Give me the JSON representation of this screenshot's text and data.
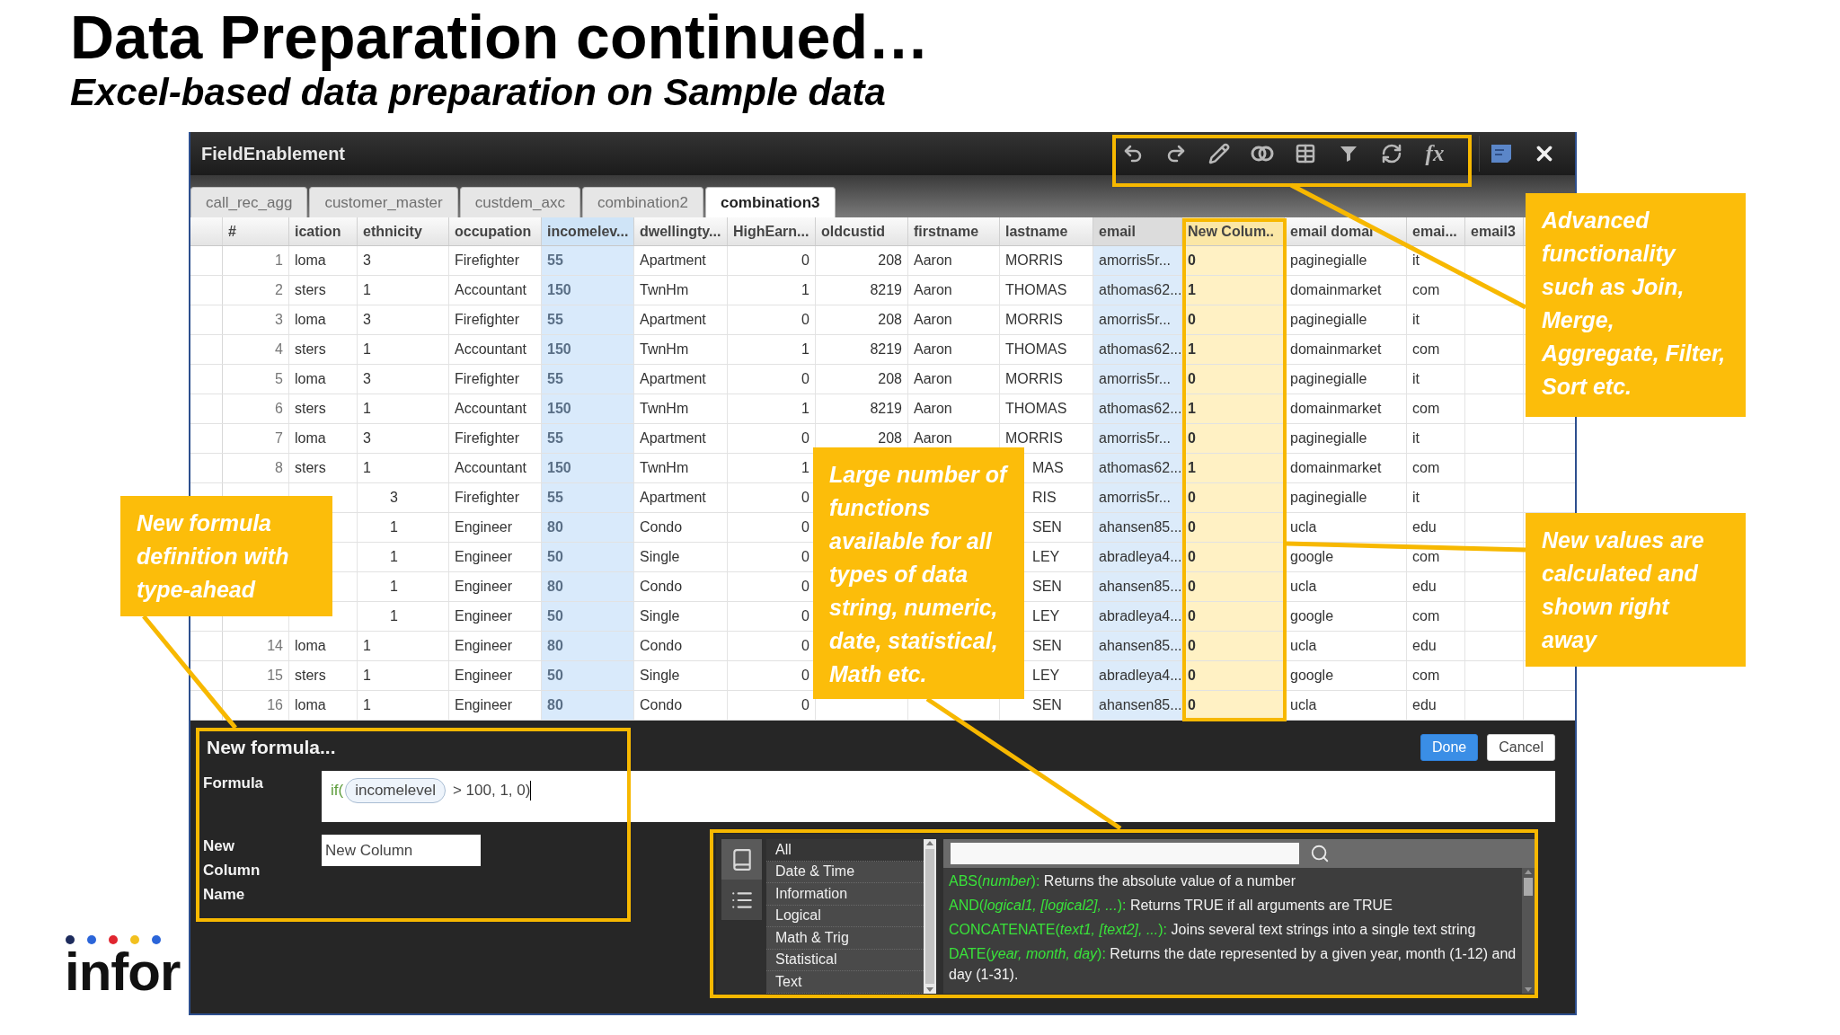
{
  "slide": {
    "title": "Data Preparation continued…",
    "subtitle": "Excel-based data preparation on Sample data",
    "logo": "infor"
  },
  "window": {
    "title": "FieldEnablement",
    "toolbar": [
      {
        "kind": "undo"
      },
      {
        "kind": "redo"
      },
      {
        "kind": "edit"
      },
      {
        "kind": "join"
      },
      {
        "kind": "table"
      },
      {
        "kind": "filter"
      },
      {
        "kind": "refresh"
      },
      {
        "kind": "formula",
        "label": "fx"
      }
    ],
    "actions": [
      {
        "kind": "note"
      },
      {
        "kind": "close"
      }
    ]
  },
  "tabs": [
    {
      "label": "call_rec_agg",
      "selected": false
    },
    {
      "label": "customer_master",
      "selected": false
    },
    {
      "label": "custdem_axc",
      "selected": false
    },
    {
      "label": "combination2",
      "selected": false
    },
    {
      "label": "combination3",
      "selected": true
    }
  ],
  "table": {
    "columns": [
      {
        "label": "#",
        "kind": "index"
      },
      {
        "label": "ication",
        "kind": "text"
      },
      {
        "label": "ethnicity",
        "kind": "text"
      },
      {
        "label": "occupation",
        "kind": "text"
      },
      {
        "label": "incomelev...",
        "kind": "source"
      },
      {
        "label": "dwellingty...",
        "kind": "text"
      },
      {
        "label": "HighEarn...",
        "kind": "number"
      },
      {
        "label": "oldcustid",
        "kind": "number"
      },
      {
        "label": "firstname",
        "kind": "text"
      },
      {
        "label": "lastname",
        "kind": "text"
      },
      {
        "label": "email",
        "kind": "tinted"
      },
      {
        "label": "New Colum..",
        "kind": "computed"
      },
      {
        "label": "email domai",
        "kind": "text"
      },
      {
        "label": "emai...",
        "kind": "text"
      },
      {
        "label": "email3",
        "kind": "text"
      }
    ],
    "rows": [
      {
        "cells": [
          "1",
          "loma",
          "3",
          "Firefighter",
          "55",
          "Apartment",
          "0",
          "208",
          "Aaron",
          "MORRIS",
          "amorris5r...",
          "0",
          "paginegialle",
          "it",
          null
        ]
      },
      {
        "cells": [
          "2",
          "sters",
          "1",
          "Accountant",
          "150",
          "TwnHm",
          "1",
          "8219",
          "Aaron",
          "THOMAS",
          "athomas62...",
          "1",
          "domainmarket",
          "com",
          null
        ]
      },
      {
        "cells": [
          "3",
          "loma",
          "3",
          "Firefighter",
          "55",
          "Apartment",
          "0",
          "208",
          "Aaron",
          "MORRIS",
          "amorris5r...",
          "0",
          "paginegialle",
          "it",
          null
        ]
      },
      {
        "cells": [
          "4",
          "sters",
          "1",
          "Accountant",
          "150",
          "TwnHm",
          "1",
          "8219",
          "Aaron",
          "THOMAS",
          "athomas62...",
          "1",
          "domainmarket",
          "com",
          null
        ]
      },
      {
        "cells": [
          "5",
          "loma",
          "3",
          "Firefighter",
          "55",
          "Apartment",
          "0",
          "208",
          "Aaron",
          "MORRIS",
          "amorris5r...",
          "0",
          "paginegialle",
          "it",
          null
        ]
      },
      {
        "cells": [
          "6",
          "sters",
          "1",
          "Accountant",
          "150",
          "TwnHm",
          "1",
          "8219",
          "Aaron",
          "THOMAS",
          "athomas62...",
          "1",
          "domainmarket",
          "com",
          null
        ]
      },
      {
        "cells": [
          "7",
          "loma",
          "3",
          "Firefighter",
          "55",
          "Apartment",
          "0",
          "208",
          "Aaron",
          "MORRIS",
          "amorris5r...",
          "0",
          "paginegialle",
          "it",
          null
        ]
      },
      {
        "cells": [
          "8",
          "sters",
          "1",
          "Accountant",
          "150",
          "TwnHm",
          "1",
          null,
          null,
          "MAS",
          "athomas62...",
          "1",
          "domainmarket",
          "com",
          null
        ]
      },
      {
        "cells": [
          null,
          null,
          "3",
          "Firefighter",
          "55",
          "Apartment",
          "0",
          null,
          null,
          "RIS",
          "amorris5r...",
          "0",
          "paginegialle",
          "it",
          null
        ]
      },
      {
        "cells": [
          null,
          null,
          "1",
          "Engineer",
          "80",
          "Condo",
          "0",
          null,
          null,
          "SEN",
          "ahansen85...",
          "0",
          "ucla",
          "edu",
          null
        ]
      },
      {
        "cells": [
          null,
          null,
          "1",
          "Engineer",
          "50",
          "Single",
          "0",
          null,
          null,
          "LEY",
          "abradleya4...",
          "0",
          "google",
          "com",
          null
        ]
      },
      {
        "cells": [
          null,
          null,
          "1",
          "Engineer",
          "80",
          "Condo",
          "0",
          null,
          null,
          "SEN",
          "ahansen85...",
          "0",
          "ucla",
          "edu",
          null
        ]
      },
      {
        "cells": [
          null,
          null,
          "1",
          "Engineer",
          "50",
          "Single",
          "0",
          null,
          null,
          "LEY",
          "abradleya4...",
          "0",
          "google",
          "com",
          null
        ]
      },
      {
        "cells": [
          "14",
          "loma",
          "1",
          "Engineer",
          "80",
          "Condo",
          "0",
          null,
          null,
          "SEN",
          "ahansen85...",
          "0",
          "ucla",
          "edu",
          null
        ]
      },
      {
        "cells": [
          "15",
          "sters",
          "1",
          "Engineer",
          "50",
          "Single",
          "0",
          null,
          null,
          "LEY",
          "abradleya4...",
          "0",
          "google",
          "com",
          null
        ]
      },
      {
        "cells": [
          "16",
          "loma",
          "1",
          "Engineer",
          "80",
          "Condo",
          "0",
          null,
          null,
          "SEN",
          "ahansen85...",
          "0",
          "ucla",
          "edu",
          null
        ]
      }
    ]
  },
  "formula_dialog": {
    "title": "New formula...",
    "formula_label": "Formula",
    "formula": {
      "function": "if(",
      "token": "incomelevel",
      "rest": "> 100, 1, 0)"
    },
    "name_label": "New Column Name",
    "name_value": "New Column",
    "buttons": [
      {
        "label": "Done",
        "kind": "primary"
      },
      {
        "label": "Cancel",
        "kind": "secondary"
      }
    ]
  },
  "function_browser": {
    "views": [
      {
        "kind": "book",
        "selected": true
      },
      {
        "kind": "list",
        "selected": false
      }
    ],
    "categories": [
      {
        "label": "All",
        "selected": true
      },
      {
        "label": "Date & Time",
        "selected": false
      },
      {
        "label": "Information",
        "selected": false
      },
      {
        "label": "Logical",
        "selected": false
      },
      {
        "label": "Math & Trig",
        "selected": false
      },
      {
        "label": "Statistical",
        "selected": false
      },
      {
        "label": "Text",
        "selected": false
      }
    ],
    "functions": [
      {
        "signature": "ABS(*number*):",
        "desc": "Returns the absolute value of a number"
      },
      {
        "signature": "AND(*logical1, [logical2], ...*):",
        "desc": "Returns TRUE if all arguments are TRUE"
      },
      {
        "signature": "CONCATENATE(*text1, [text2], ...*):",
        "desc": "Joins several text strings into a single text string"
      },
      {
        "signature": "DATE(*year, month, day*):",
        "desc": "Returns the date represented by a given year, month (1-12) and day (1-31)."
      }
    ]
  },
  "callouts": [
    {
      "text": "New formula definition with type-ahead"
    },
    {
      "text": "Large number of functions available for all types of data string, numeric, date, statistical, Math etc."
    },
    {
      "text": "Advanced functionality such as Join, Merge, Aggregate, Filter, Sort etc."
    },
    {
      "text": "New values are calculated and shown right away"
    }
  ]
}
